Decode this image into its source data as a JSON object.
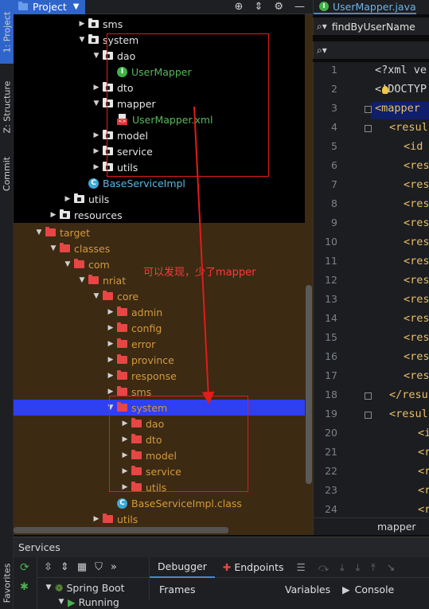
{
  "sidebar_left": {
    "tabs": [
      {
        "id": "project",
        "label": "1: Project"
      },
      {
        "id": "structure",
        "label": "Z: Structure"
      },
      {
        "id": "commit",
        "label": "Commit"
      },
      {
        "id": "favorites",
        "label": "Favorites"
      }
    ]
  },
  "project_panel": {
    "title": "Project",
    "tree_top": [
      {
        "label": "sms",
        "arrow": "right",
        "icon": "white-folder",
        "indent": 4
      },
      {
        "label": "system",
        "arrow": "down",
        "icon": "white-folder",
        "indent": 4
      },
      {
        "label": "dao",
        "arrow": "down",
        "icon": "white-folder",
        "indent": 5
      },
      {
        "label": "UserMapper",
        "arrow": "",
        "icon": "interface-green",
        "indent": 6,
        "style": "green"
      },
      {
        "label": "dto",
        "arrow": "right",
        "icon": "white-folder",
        "indent": 5
      },
      {
        "label": "mapper",
        "arrow": "down",
        "icon": "white-folder",
        "indent": 5
      },
      {
        "label": "UserMapper.xml",
        "arrow": "",
        "icon": "xml-file",
        "indent": 6,
        "style": "green"
      },
      {
        "label": "model",
        "arrow": "right",
        "icon": "white-folder",
        "indent": 5
      },
      {
        "label": "service",
        "arrow": "right",
        "icon": "white-folder",
        "indent": 5
      },
      {
        "label": "utils",
        "arrow": "right",
        "icon": "white-folder",
        "indent": 5
      },
      {
        "label": "BaseServiceImpl",
        "arrow": "",
        "icon": "class-blue",
        "indent": 4,
        "style": "cls"
      },
      {
        "label": "utils",
        "arrow": "right",
        "icon": "white-folder",
        "indent": 3
      },
      {
        "label": "resources",
        "arrow": "right",
        "icon": "white-folder",
        "indent": 2
      }
    ],
    "tree_bottom": [
      {
        "label": "target",
        "arrow": "down",
        "icon": "red-folder",
        "indent": 1,
        "style": "orange"
      },
      {
        "label": "classes",
        "arrow": "down",
        "icon": "red-folder",
        "indent": 2,
        "style": "orange"
      },
      {
        "label": "com",
        "arrow": "down",
        "icon": "red-folder",
        "indent": 3,
        "style": "orange"
      },
      {
        "label": "nriat",
        "arrow": "down",
        "icon": "red-folder",
        "indent": 4,
        "style": "orange"
      },
      {
        "label": "core",
        "arrow": "down",
        "icon": "red-folder",
        "indent": 5,
        "style": "orange"
      },
      {
        "label": "admin",
        "arrow": "right",
        "icon": "red-folder",
        "indent": 6,
        "style": "orange"
      },
      {
        "label": "config",
        "arrow": "right",
        "icon": "red-folder",
        "indent": 6,
        "style": "orange"
      },
      {
        "label": "error",
        "arrow": "right",
        "icon": "red-folder",
        "indent": 6,
        "style": "orange"
      },
      {
        "label": "province",
        "arrow": "right",
        "icon": "red-folder",
        "indent": 6,
        "style": "orange"
      },
      {
        "label": "response",
        "arrow": "right",
        "icon": "red-folder",
        "indent": 6,
        "style": "orange"
      },
      {
        "label": "sms",
        "arrow": "right",
        "icon": "red-folder",
        "indent": 6,
        "style": "orange"
      },
      {
        "label": "system",
        "arrow": "down",
        "icon": "red-folder",
        "indent": 6,
        "style": "orange",
        "selected": true
      },
      {
        "label": "dao",
        "arrow": "right",
        "icon": "red-folder",
        "indent": 7,
        "style": "orange"
      },
      {
        "label": "dto",
        "arrow": "right",
        "icon": "red-folder",
        "indent": 7,
        "style": "orange"
      },
      {
        "label": "model",
        "arrow": "right",
        "icon": "red-folder",
        "indent": 7,
        "style": "orange"
      },
      {
        "label": "service",
        "arrow": "right",
        "icon": "red-folder",
        "indent": 7,
        "style": "orange"
      },
      {
        "label": "utils",
        "arrow": "right",
        "icon": "red-folder",
        "indent": 7,
        "style": "orange"
      },
      {
        "label": "BaseServiceImpl.class",
        "arrow": "",
        "icon": "class-blue",
        "indent": 6,
        "style": "orange"
      },
      {
        "label": "utils",
        "arrow": "right",
        "icon": "red-folder",
        "indent": 5,
        "style": "orange"
      }
    ]
  },
  "annotation": {
    "text": "可以发现，少了mapper",
    "color": "#e21b1b"
  },
  "editor": {
    "tab_label": "UserMapper.java",
    "search_value": "findByUserName",
    "breadcrumb": "mapper",
    "lines": [
      {
        "n": "1",
        "code": "<?xml ve",
        "color": "#d8d8d8",
        "indent": 0
      },
      {
        "n": "2",
        "code": "<!DOCTYP",
        "color": "#d8d8d8",
        "indent": 0
      },
      {
        "n": "3",
        "code": "<mapper ",
        "color": "#e8bf6a",
        "indent": 0
      },
      {
        "n": "4",
        "code": "<resul",
        "color": "#e8bf6a",
        "indent": 1
      },
      {
        "n": "5",
        "code": "<id ",
        "color": "#e8bf6a",
        "indent": 2
      },
      {
        "n": "6",
        "code": "<res",
        "color": "#e8bf6a",
        "indent": 2
      },
      {
        "n": "7",
        "code": "<res",
        "color": "#e8bf6a",
        "indent": 2
      },
      {
        "n": "8",
        "code": "<res",
        "color": "#e8bf6a",
        "indent": 2
      },
      {
        "n": "9",
        "code": "<res",
        "color": "#e8bf6a",
        "indent": 2
      },
      {
        "n": "10",
        "code": "<res",
        "color": "#e8bf6a",
        "indent": 2
      },
      {
        "n": "11",
        "code": "<res",
        "color": "#e8bf6a",
        "indent": 2
      },
      {
        "n": "12",
        "code": "<res",
        "color": "#e8bf6a",
        "indent": 2
      },
      {
        "n": "13",
        "code": "<res",
        "color": "#e8bf6a",
        "indent": 2
      },
      {
        "n": "14",
        "code": "<res",
        "color": "#e8bf6a",
        "indent": 2
      },
      {
        "n": "15",
        "code": "<res",
        "color": "#e8bf6a",
        "indent": 2
      },
      {
        "n": "16",
        "code": "<res",
        "color": "#e8bf6a",
        "indent": 2
      },
      {
        "n": "17",
        "code": "<res",
        "color": "#e8bf6a",
        "indent": 2
      },
      {
        "n": "18",
        "code": "</resu",
        "color": "#e8bf6a",
        "indent": 1
      },
      {
        "n": "19",
        "code": "<resul",
        "color": "#e8bf6a",
        "indent": 1
      },
      {
        "n": "20",
        "code": "<i",
        "color": "#e8bf6a",
        "indent": 3
      },
      {
        "n": "21",
        "code": "<r",
        "color": "#e8bf6a",
        "indent": 3
      },
      {
        "n": "22",
        "code": "<r",
        "color": "#e8bf6a",
        "indent": 3
      },
      {
        "n": "23",
        "code": "<r",
        "color": "#e8bf6a",
        "indent": 3
      },
      {
        "n": "24",
        "code": "<r",
        "color": "#e8bf6a",
        "indent": 3
      }
    ]
  },
  "services": {
    "title": "Services",
    "tree": [
      {
        "label": "Spring Boot",
        "arrow": "down"
      },
      {
        "label": "Running",
        "arrow": "down"
      }
    ],
    "debug_tabs": [
      "Debugger",
      "Endpoints"
    ],
    "sub_tabs": [
      "Frames",
      "Variables",
      "Console"
    ]
  }
}
